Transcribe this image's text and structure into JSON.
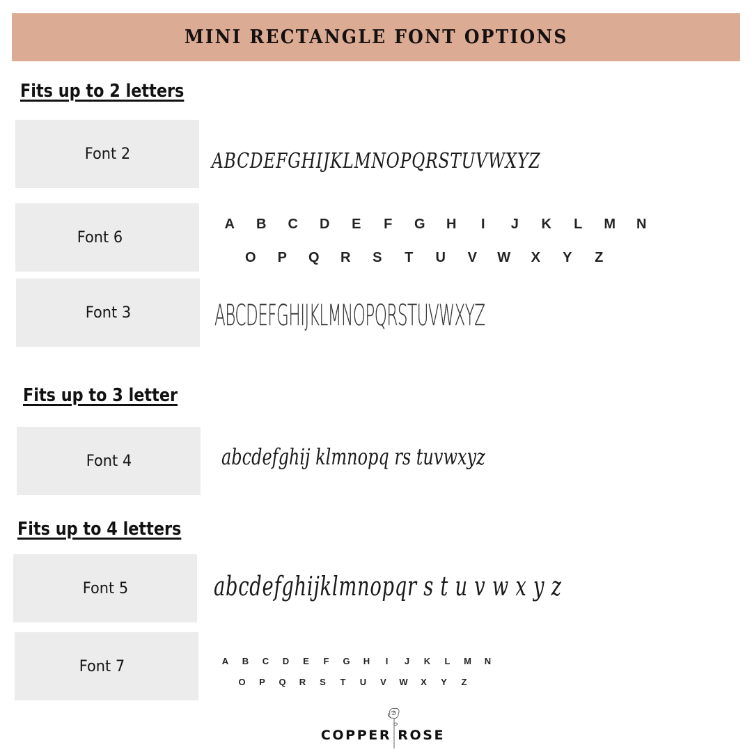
{
  "header": {
    "title": "MINI RECTANGLE FONT OPTIONS",
    "background_color": "#dbab94"
  },
  "sections": [
    {
      "heading": "Fits up to 2 letters",
      "fonts": [
        {
          "label": "Font 2",
          "sample": "ABCDEFGHIJKLMNOPQRSTUVWXYZ",
          "style": "script-uppercase"
        },
        {
          "label": "Font 6",
          "sample_rows": [
            [
              "A",
              "B",
              "C",
              "D",
              "E",
              "F",
              "G",
              "H",
              "I",
              "J",
              "K",
              "L",
              "M",
              "N"
            ],
            [
              "O",
              "P",
              "Q",
              "R",
              "S",
              "T",
              "U",
              "V",
              "W",
              "X",
              "Y",
              "Z"
            ]
          ],
          "style": "sans-uppercase"
        },
        {
          "label": "Font 3",
          "sample": "ABCDEFGHIJKLMNOPQRSTUVWXYZ",
          "style": "tall-handwritten-uppercase"
        }
      ]
    },
    {
      "heading": "Fits up to 3 letter",
      "fonts": [
        {
          "label": "Font 4",
          "sample": "abcdefghij klmnopq rs tuvwxyz",
          "style": "script-lowercase"
        }
      ]
    },
    {
      "heading": "Fits up to 4 letters",
      "fonts": [
        {
          "label": "Font 5",
          "sample": "abcdefghijklmnopqr s t u v w x y z",
          "style": "brush-script-lowercase"
        },
        {
          "label": "Font 7",
          "sample_rows": [
            [
              "A",
              "B",
              "C",
              "D",
              "E",
              "F",
              "G",
              "H",
              "I",
              "J",
              "K",
              "L",
              "M",
              "N"
            ],
            [
              "O",
              "P",
              "Q",
              "R",
              "S",
              "T",
              "U",
              "V",
              "W",
              "X",
              "Y",
              "Z"
            ]
          ],
          "style": "small-sans-uppercase"
        }
      ]
    }
  ],
  "footer": {
    "brand": "COPPER ROSE",
    "logo_icon": "rose-icon"
  },
  "colors": {
    "label_box": "#ececec",
    "text": "#111111"
  }
}
